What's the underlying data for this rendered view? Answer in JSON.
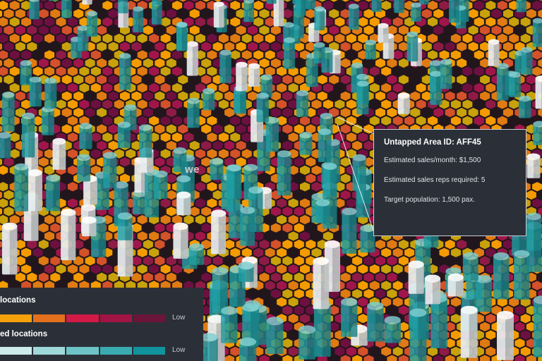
{
  "map": {
    "area_label": "we",
    "colors": {
      "ground_dark": "#22161d",
      "hex_fill": [
        "#f39b00",
        "#e07a12",
        "#c9a10a",
        "#d4512a",
        "#8e1b46",
        "#a0164a",
        "#6d1040"
      ],
      "column_teal": "#1f9ea3",
      "column_pale": "#e8eef0"
    }
  },
  "tooltip": {
    "title": "Untapped Area ID:  AFF45",
    "lines": [
      "Estimated sales/month: $1,500",
      "Estimated sales reps required: 5",
      "Target population: 1,500 pax."
    ]
  },
  "legend": {
    "sections": [
      {
        "title": "locations",
        "low_label": "Low",
        "swatches": [
          "#f4a10c",
          "#e4701d",
          "#d21a47",
          "#a21443",
          "#6a1539"
        ]
      },
      {
        "title": "ed locations",
        "low_label": "Low",
        "swatches": [
          "#cdebea",
          "#9fd8d9",
          "#6ec3c6",
          "#3aabb1",
          "#10939c"
        ]
      }
    ]
  }
}
